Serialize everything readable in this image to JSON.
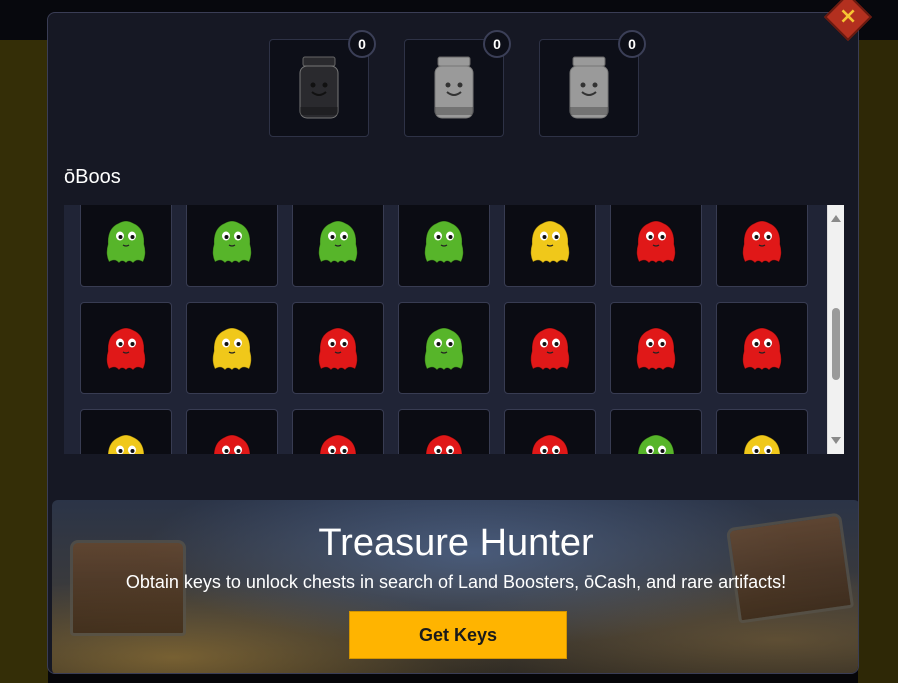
{
  "close_label": "×",
  "jars": [
    {
      "count": "0",
      "variant": "dark",
      "icon": "jar-icon"
    },
    {
      "count": "0",
      "variant": "light",
      "icon": "jar-icon"
    },
    {
      "count": "0",
      "variant": "light",
      "icon": "jar-icon"
    }
  ],
  "section": {
    "title": "ōBoos"
  },
  "boo_colors": {
    "green": "#57b52a",
    "yellow": "#f0c81a",
    "red": "#e01818"
  },
  "grid": {
    "rows": [
      [
        "green",
        "green",
        "green",
        "green",
        "yellow",
        "red",
        "red"
      ],
      [
        "red",
        "yellow",
        "red",
        "green",
        "red",
        "red",
        "red"
      ],
      [
        "yellow",
        "red",
        "red",
        "red",
        "red",
        "green",
        "yellow"
      ]
    ]
  },
  "banner": {
    "title": "Treasure Hunter",
    "text": "Obtain keys to unlock chests in search of Land Boosters, ōCash, and rare artifacts!",
    "button": "Get Keys",
    "button_color": "#ffb400"
  }
}
